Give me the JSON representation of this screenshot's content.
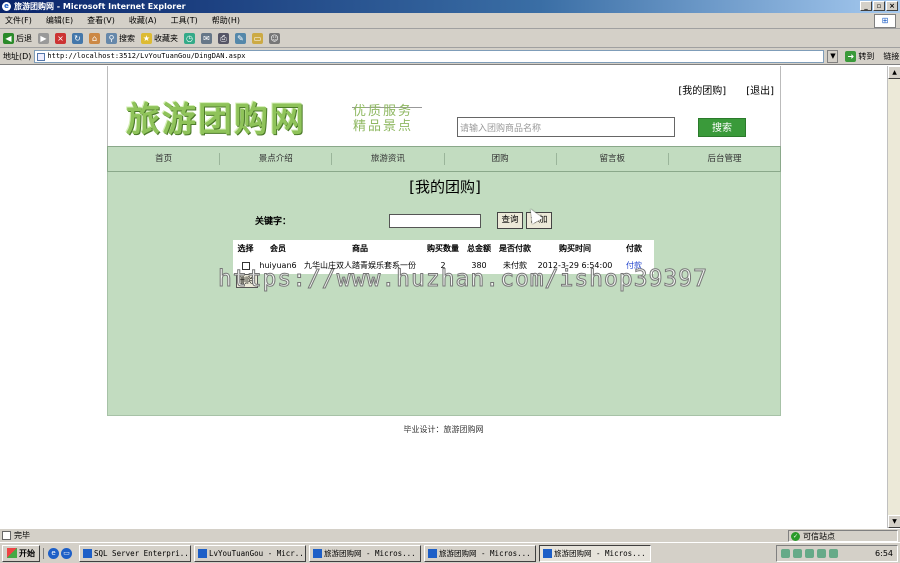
{
  "window": {
    "title": "旅游团购网 - Microsoft Internet Explorer",
    "controls": [
      "_",
      "▫",
      "×"
    ]
  },
  "menu": [
    "文件(F)",
    "编辑(E)",
    "查看(V)",
    "收藏(A)",
    "工具(T)",
    "帮助(H)"
  ],
  "toolbar": {
    "back": "后退",
    "search": "搜索",
    "favorites": "收藏夹"
  },
  "address": {
    "label": "地址(D)",
    "url": "http://localhost:3512/LvYouTuanGou/DingDAN.aspx",
    "go": "转到",
    "links": "链接"
  },
  "site": {
    "my_group": "[我的团购]",
    "logout": "[退出]",
    "logo": "旅游团购网",
    "slogan1": "优质服务",
    "slogan2": "精品景点",
    "search_placeholder": "请输入团购商品名称",
    "search_button": "搜索",
    "nav": [
      "首页",
      "景点介绍",
      "旅游资讯",
      "团购",
      "留言板",
      "后台管理"
    ]
  },
  "content": {
    "heading": "[我的团购]",
    "keyword_label": "关键字：",
    "keyword_value": "",
    "query_button": "查询",
    "add_button": "添加",
    "columns": [
      "选择",
      "会员",
      "商品",
      "购买数量",
      "总金额",
      "是否付款",
      "购买时间",
      "付款"
    ],
    "rows": [
      {
        "member": "huiyuan6",
        "goods": "九华山庄双人踏青娱乐套系一份",
        "qty": "2",
        "amount": "380",
        "paid": "未付款",
        "time": "2012-3-29 6:54:00",
        "pay": "付款"
      }
    ],
    "delete_button": "删除"
  },
  "watermark": "https://www.huzhan.com/ishop39397",
  "footer": "毕业设计：旅游团购网",
  "statusbar": {
    "status": "完毕",
    "zone": "可信站点"
  },
  "taskbar": {
    "start": "开始",
    "tasks": [
      "SQL Server Enterpri...",
      "LvYouTuanGou - Micr...",
      "旅游团购网 - Micros...",
      "旅游团购网 - Micros...",
      "旅游团购网 - Micros..."
    ],
    "clock": "6:54"
  }
}
